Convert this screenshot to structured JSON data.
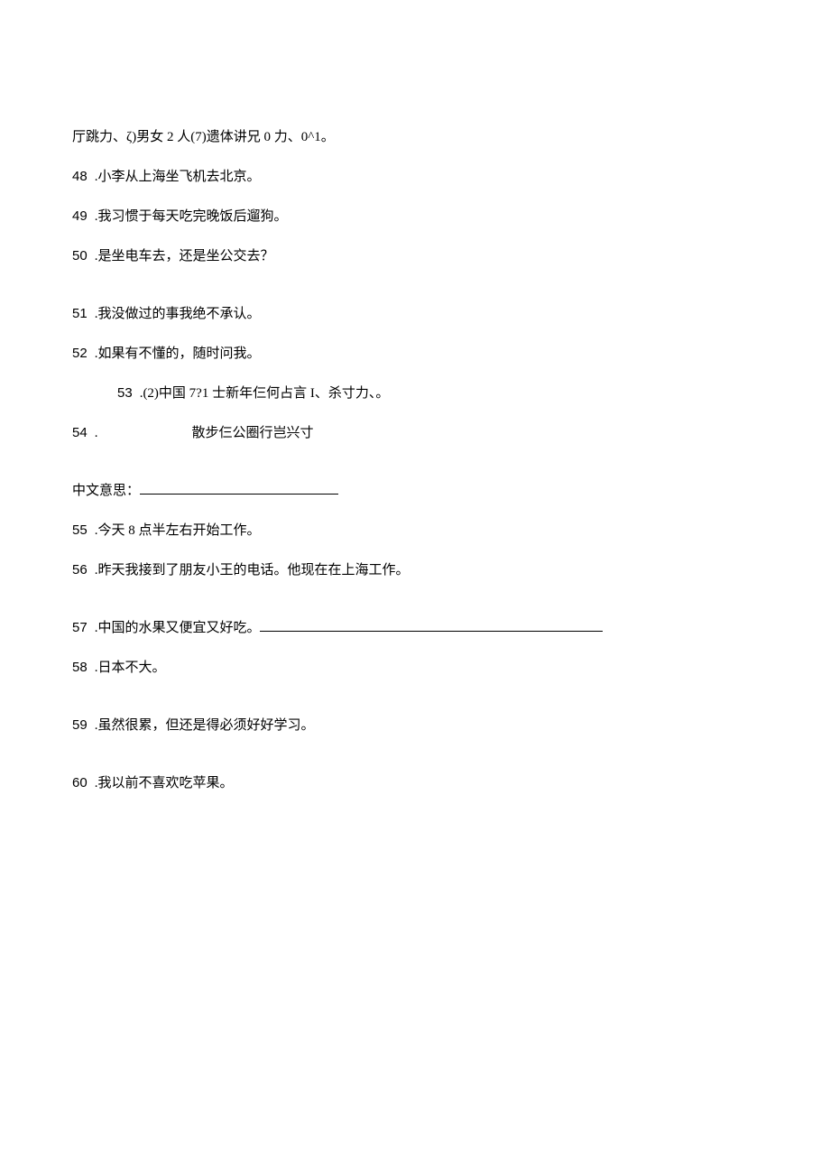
{
  "lines": {
    "intro": "厅跳力、ζ)男女 2 人(7)遗体讲兄 0 力、0^1。",
    "q48_num": "48",
    "q48_text": ".小李从上海坐飞机去北京。",
    "q49_num": "49",
    "q49_text": ".我习惯于每天吃完晚饭后遛狗。",
    "q50_num": "50",
    "q50_text": ".是坐电车去，还是坐公交去？",
    "q51_num": "51",
    "q51_text": ".我没做过的事我绝不承认。",
    "q52_num": "52",
    "q52_text": ".如果有不懂的，随时问我。",
    "q53_num": "53",
    "q53_text": ".(2)中国 7?1 士新年仨何占言 I、杀寸力、。",
    "q54_num": "54",
    "q54_text": ".",
    "q54_tail": "散步仨公圈行岂兴寸",
    "meaning_label": "中文意思：",
    "q55_num": "55",
    "q55_text": ".今天 8 点半左右开始工作。",
    "q56_num": "56",
    "q56_text": ".昨天我接到了朋友小王的电话。他现在在上海工作。",
    "q57_num": "57",
    "q57_text": ".中国的水果又便宜又好吃。",
    "q58_num": "58",
    "q58_text": ".日本不大。",
    "q59_num": "59",
    "q59_text": ".虽然很累，但还是得必须好好学习。",
    "q60_num": "60",
    "q60_text": ".我以前不喜欢吃苹果。"
  }
}
